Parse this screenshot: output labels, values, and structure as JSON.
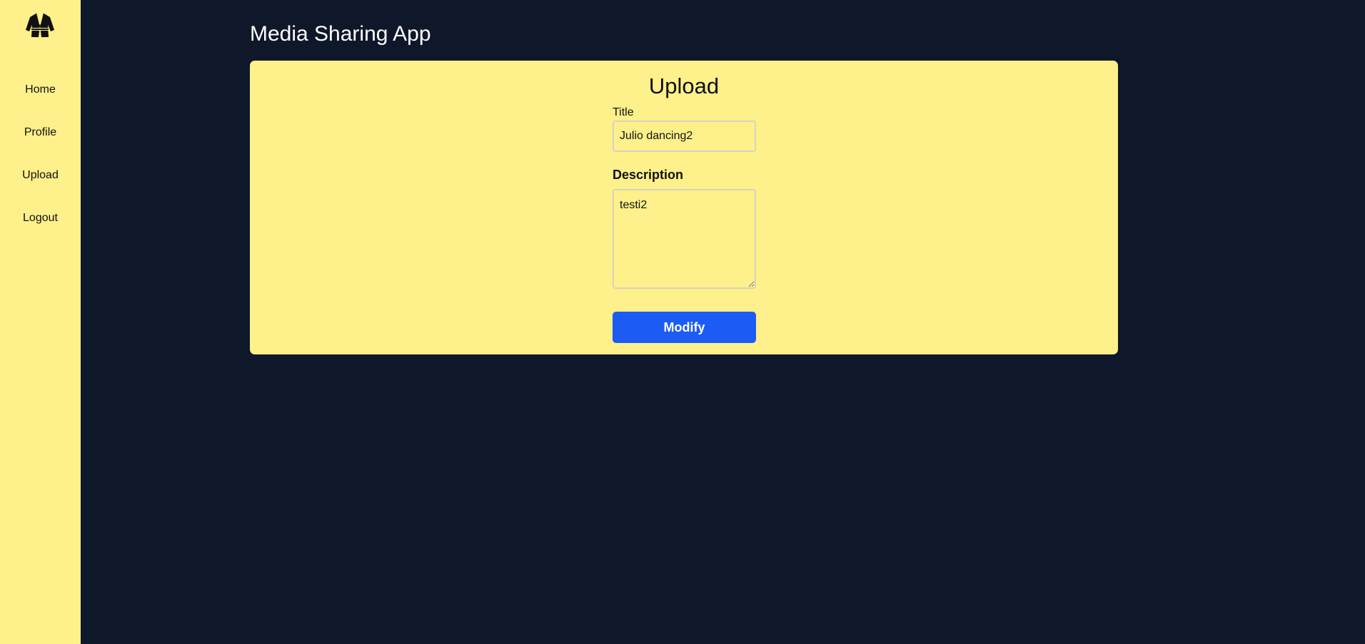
{
  "app": {
    "title": "Media Sharing App",
    "logo_icon": "karate-gi-icon"
  },
  "sidebar": {
    "items": [
      {
        "label": "Home"
      },
      {
        "label": "Profile"
      },
      {
        "label": "Upload"
      },
      {
        "label": "Logout"
      }
    ]
  },
  "form": {
    "heading": "Upload",
    "title_label": "Title",
    "title_value": "Julio dancing2",
    "description_label": "Description",
    "description_value": "testi2",
    "submit_label": "Modify"
  },
  "colors": {
    "background": "#0f172a",
    "accent_yellow": "#fef08a",
    "button_blue": "#1c5cf5"
  }
}
